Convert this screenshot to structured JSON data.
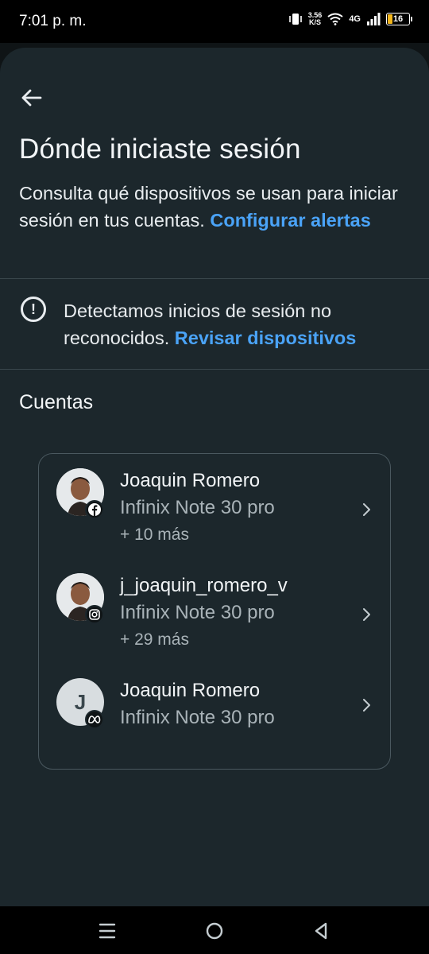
{
  "status_bar": {
    "time": "7:01 p. m.",
    "speed_value": "3.56",
    "speed_unit": "K/S",
    "network": "4G",
    "battery": "16",
    "battery_color": "#f2b61c"
  },
  "header": {
    "back_icon": "arrow-left-icon",
    "title": "Dónde iniciaste sesión",
    "description": "Consulta qué dispositivos se usan para iniciar sesión en tus cuentas.",
    "description_link": "Configurar alertas"
  },
  "alert": {
    "icon": "alert-circle-icon",
    "text": "Detectamos inicios de sesión no reconocidos.",
    "link": "Revisar dispositivos"
  },
  "accounts_section": {
    "title": "Cuentas",
    "accounts": [
      {
        "name": "Joaquin Romero",
        "device": "Infinix Note 30 pro",
        "more": "+ 10 más",
        "platform_icon": "facebook-icon"
      },
      {
        "name": "j_joaquin_romero_v",
        "device": "Infinix Note 30 pro",
        "more": "+ 29 más",
        "platform_icon": "instagram-icon"
      },
      {
        "name": "Joaquin Romero",
        "device": "Infinix Note 30 pro",
        "avatar_initial": "J",
        "platform_icon": "meta-icon"
      }
    ]
  },
  "colors": {
    "background": "#1c272c",
    "accent_link": "#4aa3f7"
  }
}
